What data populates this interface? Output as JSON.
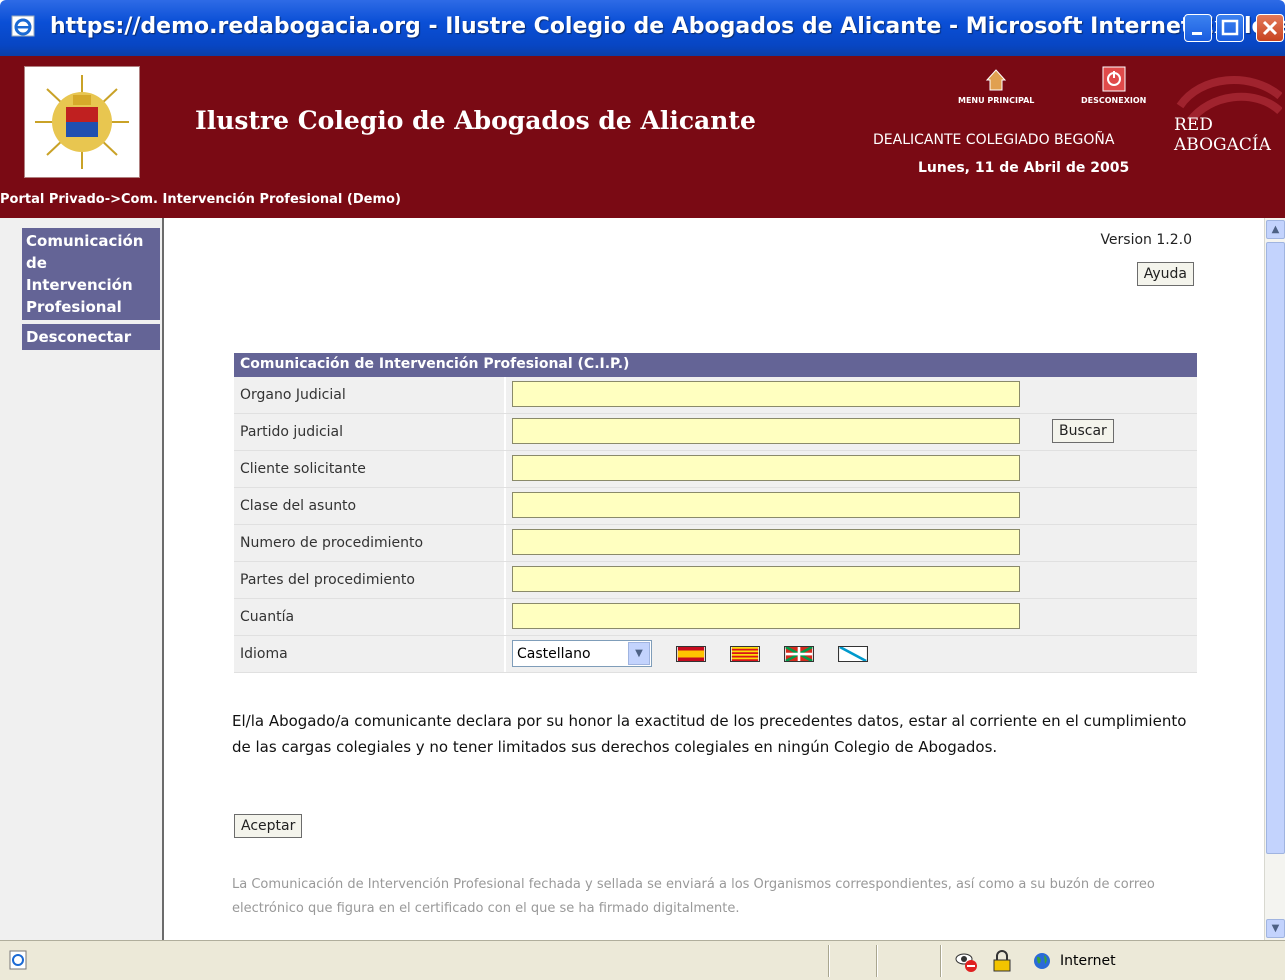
{
  "window": {
    "title": "https://demo.redabogacia.org - Ilustre Colegio de Abogados de Alicante - Microsoft Internet Explorer"
  },
  "header": {
    "org_title": "Ilustre Colegio de Abogados de Alicante",
    "menu_principal": "MENU PRINCIPAL",
    "desconexion": "DESCONEXION",
    "user": "DEALICANTE COLEGIADO BEGOÑA",
    "date": "Lunes, 11 de Abril de 2005",
    "breadcrumb": "Portal Privado->Com. Intervención Profesional (Demo)",
    "brand_line1": "RED",
    "brand_line2": "ABOGACÍA"
  },
  "sidebar": {
    "items": [
      {
        "label": "Comunicación de Intervención Profesional"
      },
      {
        "label": "Desconectar"
      }
    ]
  },
  "main": {
    "version": "Version 1.2.0",
    "help_label": "Ayuda",
    "form": {
      "title": "Comunicación de Intervención Profesional (C.I.P.)",
      "fields": [
        {
          "label": "Organo Judicial",
          "value": ""
        },
        {
          "label": "Partido judicial",
          "value": ""
        },
        {
          "label": "Cliente solicitante",
          "value": ""
        },
        {
          "label": "Clase del asunto",
          "value": ""
        },
        {
          "label": "Numero de procedimiento",
          "value": ""
        },
        {
          "label": "Partes del procedimiento",
          "value": ""
        },
        {
          "label": "Cuantía",
          "value": ""
        }
      ],
      "buscar_label": "Buscar",
      "idioma_label": "Idioma",
      "idioma_selected": "Castellano",
      "flags": [
        "spain-flag",
        "catalonia-flag",
        "basque-flag",
        "galicia-flag"
      ]
    },
    "declaration": "El/la Abogado/a comunicante declara por su honor la exactitud de los precedentes datos, estar al corriente en el cumplimiento de las cargas colegiales y no tener limitados sus derechos colegiales en ningún Colegio de Abogados.",
    "accept_label": "Aceptar",
    "footer_note": "La Comunicación de Intervención Profesional fechada y sellada se enviará a los Organismos correspondientes, así como a su buzón de correo electrónico que figura en el certificado con el que se ha firmado digitalmente."
  },
  "statusbar": {
    "zone": "Internet"
  },
  "colors": {
    "header_bg": "#7a0a14",
    "accent": "#646496",
    "input_bg": "#ffffc0"
  }
}
